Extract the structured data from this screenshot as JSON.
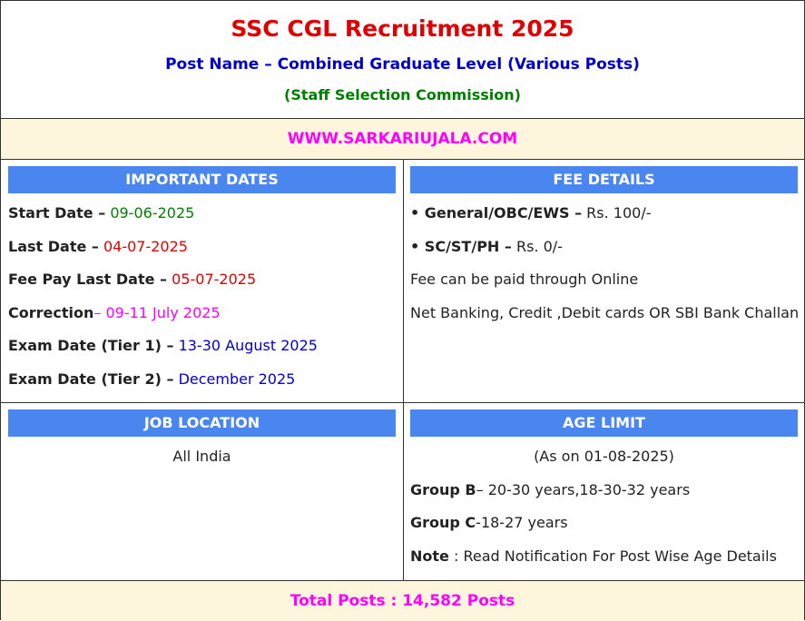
{
  "header": {
    "title": "SSC CGL Recruitment 2025",
    "subtitle": "Post Name – Combined Graduate Level (Various Posts)",
    "org": "(Staff Selection Commission)"
  },
  "site": "WWW.SARKARIUJALA.COM",
  "important_dates": {
    "heading": "IMPORTANT DATES",
    "items": [
      {
        "label": "Start Date –",
        "value": " 09-06-2025"
      },
      {
        "label": "Last Date –",
        "value": " 04-07-2025"
      },
      {
        "label": "Fee Pay Last Date –",
        "value": " 05-07-2025"
      },
      {
        "label": "Correction",
        "value": "– 09-11 July 2025"
      },
      {
        "label": "Exam Date (Tier 1) –",
        "value": " 13-30 August 2025"
      },
      {
        "label": "Exam Date (Tier 2) –",
        "value": " December 2025"
      }
    ]
  },
  "fee_details": {
    "heading": "FEE DETAILS",
    "items": [
      {
        "label": "• General/OBC/EWS –",
        "value": " Rs. 100/-"
      },
      {
        "label": "• SC/ST/PH –",
        "value": " Rs. 0/-"
      }
    ],
    "note1": "Fee can be paid through Online",
    "note2": "Net Banking, Credit ,Debit cards OR SBI Bank Challan"
  },
  "job_location": {
    "heading": "JOB LOCATION",
    "value": "All India"
  },
  "age_limit": {
    "heading": "AGE LIMIT",
    "as_on": "(As on 01-08-2025)",
    "items": [
      {
        "label": "Group B",
        "value": "– 20-30 years,18-30-32 years"
      },
      {
        "label": "Group C",
        "value": "-18-27 years"
      },
      {
        "label": "Note",
        "value": " : Read Notification For Post Wise Age Details"
      }
    ]
  },
  "footer": "Total Posts : 14,582 Posts",
  "colors": {
    "title": "#e00000",
    "subtitle": "#0000cc",
    "org": "#008000",
    "magenta": "#ff00ff",
    "section_header": "#4a86f0",
    "band": "#fdf6dc"
  }
}
